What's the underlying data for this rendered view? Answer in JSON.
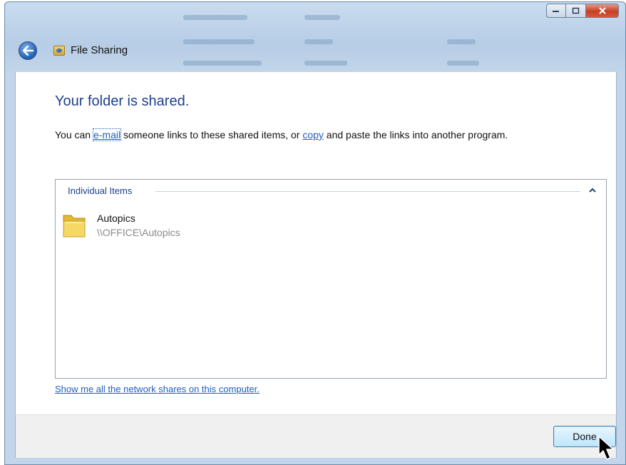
{
  "window": {
    "title": "File Sharing",
    "app_icon": "file-sharing-icon",
    "back_icon": "back-arrow-icon",
    "controls": {
      "minimize": "minimize-icon",
      "maximize": "maximize-icon",
      "close": "close-icon"
    }
  },
  "main": {
    "heading": "Your folder is shared.",
    "desc_prefix": "You can ",
    "email_link": "e-mail",
    "desc_middle": " someone links to these shared items, or ",
    "copy_link": "copy",
    "desc_suffix": " and paste the links into another program.",
    "group": {
      "header": "Individual Items",
      "chevron_icon": "chevron-up-icon",
      "items": [
        {
          "name": "Autopics",
          "path": "\\\\OFFICE\\Autopics",
          "icon": "folder-icon"
        }
      ]
    },
    "network_link": "Show me all the network shares on this computer."
  },
  "footer": {
    "done_label": "Done"
  },
  "colors": {
    "heading": "#1e3f8c",
    "link": "#1f5fbf",
    "path_text": "#8a8a8a",
    "footer_bg": "#f0f0f0"
  }
}
